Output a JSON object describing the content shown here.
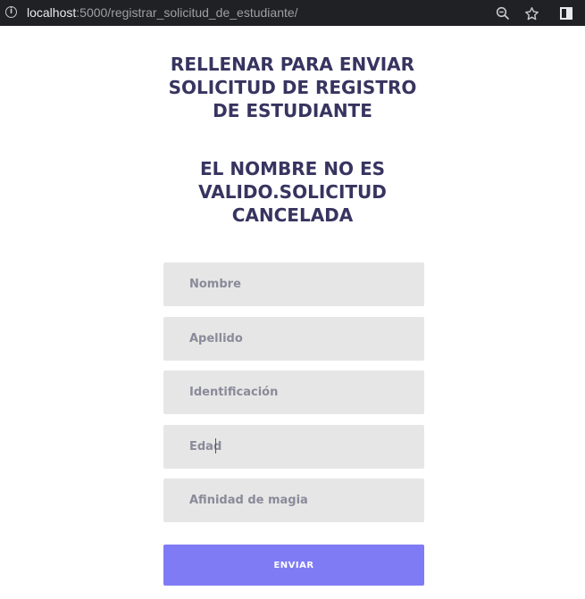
{
  "browser": {
    "url_host": "localhost",
    "url_path": ":5000/registrar_solicitud_de_estudiante/",
    "icons": [
      "info-icon",
      "zoom-icon",
      "bookmark-star-icon",
      "sidepanel-icon"
    ]
  },
  "page": {
    "title": "RELLENAR PARA ENVIAR SOLICITUD DE REGISTRO DE ESTUDIANTE",
    "message": "EL NOMBRE NO ES VALIDO.SOLICITUD CANCELADA"
  },
  "form": {
    "nombre_placeholder": "Nombre",
    "apellido_placeholder": "Apellido",
    "identificacion_placeholder": "Identificación",
    "edad_value": "Edad",
    "afinidad_placeholder": "Afinidad de magia",
    "submit_label": "ENVIAR"
  },
  "colors": {
    "heading": "#373460",
    "field_bg": "#e6e6e6",
    "submit_bg": "#7f7bf5"
  }
}
